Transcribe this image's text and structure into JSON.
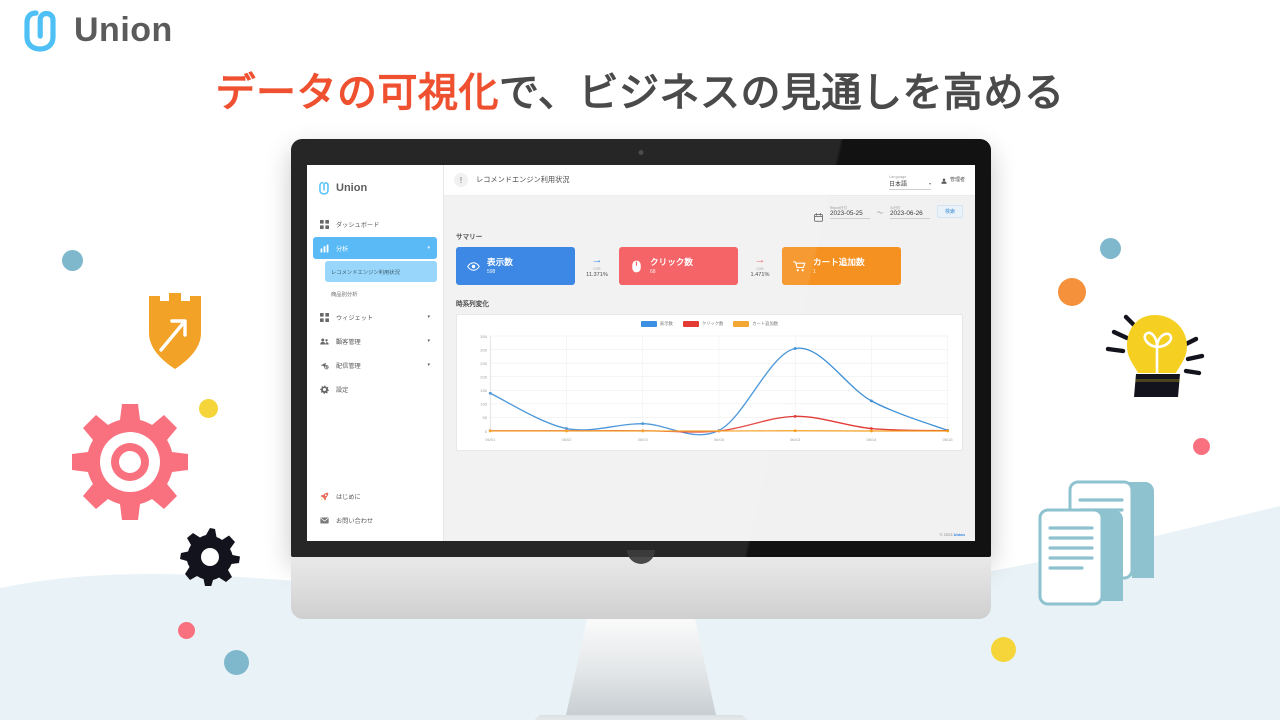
{
  "brand": {
    "name": "Union",
    "logo_icon": "union-paperclip-logo"
  },
  "headline": {
    "accent": "データの可視化",
    "rest": "で、ビジネスの見通しを高める",
    "accent_color": "#ef5130",
    "rest_color": "#4a4a4a"
  },
  "app": {
    "sidebar": {
      "logo": "Union",
      "items": [
        {
          "label": "ダッシュボード",
          "icon": "grid-dashboard-icon",
          "has_caret": false,
          "active": false
        },
        {
          "label": "分析",
          "icon": "bar-chart-icon",
          "has_caret": true,
          "active": true
        },
        {
          "label": "ウィジェット",
          "icon": "widget-grid-icon",
          "has_caret": true,
          "active": false
        },
        {
          "label": "顧客管理",
          "icon": "people-icon",
          "has_caret": true,
          "active": false
        },
        {
          "label": "配信管理",
          "icon": "send-clock-icon",
          "has_caret": true,
          "active": false
        },
        {
          "label": "設定",
          "icon": "gear-icon",
          "has_caret": false,
          "active": false
        }
      ],
      "sub_items": [
        {
          "label": "レコメンドエンジン利用状況",
          "active": true
        },
        {
          "label": "商品別分析",
          "active": false
        }
      ],
      "bottom_items": [
        {
          "label": "はじめに",
          "icon": "rocket-icon"
        },
        {
          "label": "お問い合わせ",
          "icon": "mail-icon"
        }
      ]
    },
    "topbar": {
      "info_icon": "info-icon",
      "page_title": "レコメンドエンジン利用状況",
      "language_label": "Language",
      "language_value": "日本語",
      "user_name": "管理者",
      "user_icon": "user-avatar-icon"
    },
    "filters": {
      "calendar_icon": "calendar-icon",
      "from_label": "Report日付",
      "from_value": "2023-05-25",
      "separator": "〜",
      "to_label": "To日付",
      "to_value": "2023-06-26",
      "search_label": "検索"
    },
    "summary": {
      "title": "サマリー",
      "cards": [
        {
          "label": "表示数",
          "value": "598",
          "icon": "eye-icon",
          "color": "#2a7de1"
        },
        {
          "label": "クリック数",
          "value": "68",
          "icon": "mouse-icon",
          "color": "#f4565a"
        },
        {
          "label": "カート追加数",
          "value": "1",
          "icon": "cart-icon",
          "color": "#f59120"
        }
      ],
      "conversions": [
        {
          "label": "CVR",
          "value": "11.371%",
          "arrow": "→",
          "color": "#2a7de1"
        },
        {
          "label": "CVR",
          "value": "1.471%",
          "arrow": "→",
          "color": "#f4565a"
        }
      ]
    },
    "timeseries": {
      "title": "時系列変化"
    },
    "footer": {
      "copyright_prefix": "© 2023 ",
      "copyright_brand": "Union"
    }
  },
  "chart_data": {
    "type": "line",
    "title": "時系列変化",
    "xlabel": "",
    "ylabel": "",
    "ylim": [
      0,
      350
    ],
    "yticks": [
      0,
      50,
      100,
      150,
      200,
      250,
      300,
      350
    ],
    "grid": true,
    "legend_position": "top-center",
    "categories": [
      "06/01",
      "06/02",
      "06/03",
      "06/08",
      "06/13",
      "06/14",
      "06/15"
    ],
    "series": [
      {
        "name": "表示数",
        "color": "#3d8fd6",
        "values": [
          139,
          9,
          27,
          2,
          304,
          111,
          2
        ]
      },
      {
        "name": "クリック数",
        "color": "#e23c38",
        "values": [
          1,
          1,
          1,
          0,
          54,
          9,
          1
        ]
      },
      {
        "name": "カート追加数",
        "color": "#f3a020",
        "values": [
          0,
          0,
          0,
          0,
          1,
          0,
          0
        ]
      }
    ]
  },
  "decorations": [
    {
      "name": "shield-arrow-icon",
      "color": "#f2a227"
    },
    {
      "name": "gear-large-icon",
      "color": "#f9707f"
    },
    {
      "name": "gear-small-icon",
      "color": "#1b1b24"
    },
    {
      "name": "lightbulb-icon",
      "color": "#f5cf22"
    },
    {
      "name": "documents-icon",
      "color": "#8ec2cf"
    }
  ]
}
